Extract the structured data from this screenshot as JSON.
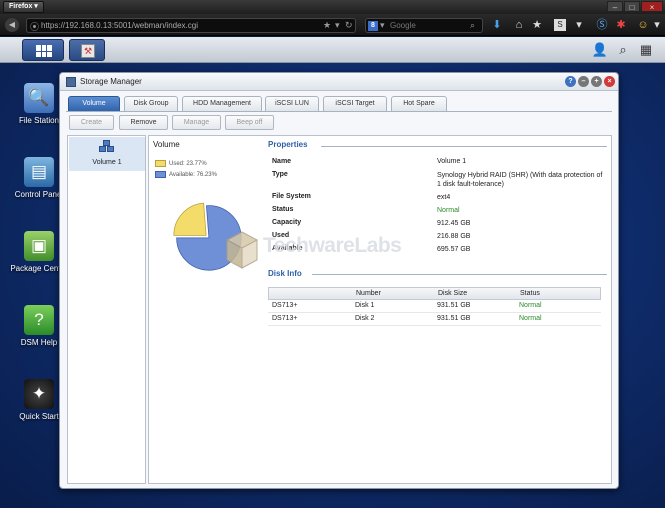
{
  "browser": {
    "app_button": "Firefox",
    "url": "https://192.168.0.13:5001/webman/index.cgi",
    "search_engine_icon": "google-icon",
    "search_placeholder": "Google",
    "window_controls": {
      "minimize": "–",
      "maximize": "□",
      "close": "×"
    }
  },
  "desktop": {
    "icons": [
      {
        "label": "File Station",
        "icon": "magnifier-icon"
      },
      {
        "label": "Control Panel",
        "icon": "control-panel-icon"
      },
      {
        "label": "Package Center",
        "icon": "package-icon"
      },
      {
        "label": "DSM Help",
        "icon": "help-icon"
      },
      {
        "label": "Quick Start",
        "icon": "wand-icon"
      }
    ]
  },
  "window": {
    "title": "Storage Manager",
    "tabs": [
      {
        "label": "Volume",
        "active": true
      },
      {
        "label": "Disk Group",
        "active": false
      },
      {
        "label": "HDD Management",
        "active": false
      },
      {
        "label": "iSCSI LUN",
        "active": false
      },
      {
        "label": "iSCSI Target",
        "active": false
      },
      {
        "label": "Hot Spare",
        "active": false
      }
    ],
    "toolbar": {
      "create": "Create",
      "remove": "Remove",
      "manage": "Manage",
      "beep_off": "Beep off"
    },
    "volumes": [
      {
        "label": "Volume 1"
      }
    ],
    "volume_panel_title": "Volume",
    "usage": {
      "used_label": "Used: 23.77%",
      "available_label": "Available: 76.23%",
      "used_fraction": 0.2377,
      "available_fraction": 0.7623,
      "used_color": "#f3dc6a",
      "available_color": "#6f8fd6"
    },
    "properties": {
      "title": "Properties",
      "rows": [
        {
          "label": "Name",
          "value": "Volume 1"
        },
        {
          "label": "Type",
          "value": "Synology Hybrid RAID (SHR) (With data protection of 1 disk fault-tolerance)"
        },
        {
          "label": "File System",
          "value": "ext4"
        },
        {
          "label": "Status",
          "value": "Normal"
        },
        {
          "label": "Capacity",
          "value": "912.45 GB"
        },
        {
          "label": "Used",
          "value": "216.88 GB"
        },
        {
          "label": "Available",
          "value": "695.57 GB"
        }
      ]
    },
    "disk_info": {
      "title": "Disk Info",
      "headers": [
        "",
        "Number",
        "Disk Size",
        "Status"
      ],
      "rows": [
        [
          "DS713+",
          "Disk 1",
          "931.51 GB",
          "Normal"
        ],
        [
          "DS713+",
          "Disk 2",
          "931.51 GB",
          "Normal"
        ]
      ]
    }
  },
  "watermark": {
    "text": "TechwareLabs"
  },
  "colors": {
    "accent": "#2f63ad",
    "status_ok": "#2a8a2a"
  }
}
